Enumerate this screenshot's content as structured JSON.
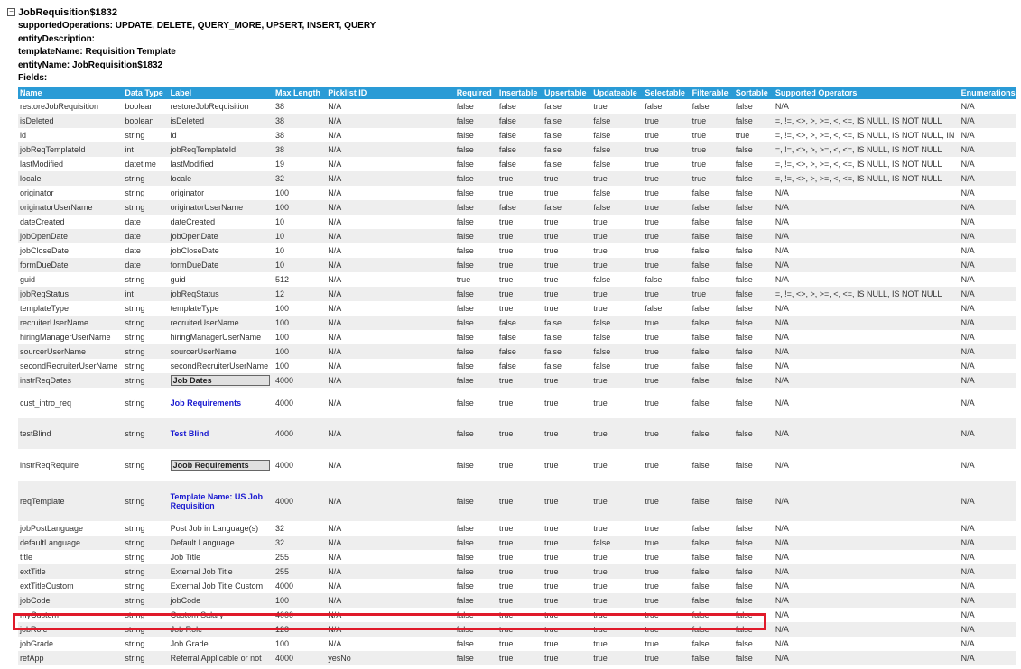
{
  "entity": {
    "title": "JobRequisition$1832",
    "meta": [
      {
        "key": "supportedOperations:",
        "value": "UPDATE, DELETE, QUERY_MORE, UPSERT, INSERT, QUERY"
      },
      {
        "key": "entityDescription:",
        "value": ""
      },
      {
        "key": "templateName:",
        "value": "Requisition Template"
      },
      {
        "key": "entityName:",
        "value": "JobRequisition$1832"
      },
      {
        "key": "Fields:",
        "value": ""
      }
    ]
  },
  "table": {
    "columns": [
      "Name",
      "Data Type",
      "Label",
      "Max Length",
      "Picklist ID",
      "Required",
      "Insertable",
      "Upsertable",
      "Updateable",
      "Selectable",
      "Filterable",
      "Sortable",
      "Supported Operators",
      "Enumerations"
    ],
    "rows": [
      [
        "restoreJobRequisition",
        "boolean",
        "restoreJobRequisition",
        "38",
        "N/A",
        "false",
        "false",
        "false",
        "true",
        "false",
        "false",
        "false",
        "N/A",
        "N/A"
      ],
      [
        "isDeleted",
        "boolean",
        "isDeleted",
        "38",
        "N/A",
        "false",
        "false",
        "false",
        "false",
        "true",
        "true",
        "false",
        "=, !=, <>, >, >=, <, <=, IS NULL, IS NOT NULL",
        "N/A"
      ],
      [
        "id",
        "string",
        "id",
        "38",
        "N/A",
        "false",
        "false",
        "false",
        "false",
        "true",
        "true",
        "true",
        "=, !=, <>, >, >=, <, <=, IS NULL, IS NOT NULL, IN",
        "N/A"
      ],
      [
        "jobReqTemplateId",
        "int",
        "jobReqTemplateId",
        "38",
        "N/A",
        "false",
        "false",
        "false",
        "false",
        "true",
        "true",
        "false",
        "=, !=, <>, >, >=, <, <=, IS NULL, IS NOT NULL",
        "N/A"
      ],
      [
        "lastModified",
        "datetime",
        "lastModified",
        "19",
        "N/A",
        "false",
        "false",
        "false",
        "false",
        "true",
        "true",
        "false",
        "=, !=, <>, >, >=, <, <=, IS NULL, IS NOT NULL",
        "N/A"
      ],
      [
        "locale",
        "string",
        "locale",
        "32",
        "N/A",
        "false",
        "true",
        "true",
        "true",
        "true",
        "true",
        "false",
        "=, !=, <>, >, >=, <, <=, IS NULL, IS NOT NULL",
        "N/A"
      ],
      [
        "originator",
        "string",
        "originator",
        "100",
        "N/A",
        "false",
        "true",
        "true",
        "false",
        "true",
        "false",
        "false",
        "N/A",
        "N/A"
      ],
      [
        "originatorUserName",
        "string",
        "originatorUserName",
        "100",
        "N/A",
        "false",
        "false",
        "false",
        "false",
        "true",
        "false",
        "false",
        "N/A",
        "N/A"
      ],
      [
        "dateCreated",
        "date",
        "dateCreated",
        "10",
        "N/A",
        "false",
        "true",
        "true",
        "true",
        "true",
        "false",
        "false",
        "N/A",
        "N/A"
      ],
      [
        "jobOpenDate",
        "date",
        "jobOpenDate",
        "10",
        "N/A",
        "false",
        "true",
        "true",
        "true",
        "true",
        "false",
        "false",
        "N/A",
        "N/A"
      ],
      [
        "jobCloseDate",
        "date",
        "jobCloseDate",
        "10",
        "N/A",
        "false",
        "true",
        "true",
        "true",
        "true",
        "false",
        "false",
        "N/A",
        "N/A"
      ],
      [
        "formDueDate",
        "date",
        "formDueDate",
        "10",
        "N/A",
        "false",
        "true",
        "true",
        "true",
        "true",
        "false",
        "false",
        "N/A",
        "N/A"
      ],
      [
        "guid",
        "string",
        "guid",
        "512",
        "N/A",
        "true",
        "true",
        "true",
        "false",
        "false",
        "false",
        "false",
        "N/A",
        "N/A"
      ],
      [
        "jobReqStatus",
        "int",
        "jobReqStatus",
        "12",
        "N/A",
        "false",
        "true",
        "true",
        "true",
        "true",
        "true",
        "false",
        "=, !=, <>, >, >=, <, <=, IS NULL, IS NOT NULL",
        "N/A"
      ],
      [
        "templateType",
        "string",
        "templateType",
        "100",
        "N/A",
        "false",
        "true",
        "true",
        "true",
        "false",
        "false",
        "false",
        "N/A",
        "N/A"
      ],
      [
        "recruiterUserName",
        "string",
        "recruiterUserName",
        "100",
        "N/A",
        "false",
        "false",
        "false",
        "false",
        "true",
        "false",
        "false",
        "N/A",
        "N/A"
      ],
      [
        "hiringManagerUserName",
        "string",
        "hiringManagerUserName",
        "100",
        "N/A",
        "false",
        "false",
        "false",
        "false",
        "true",
        "false",
        "false",
        "N/A",
        "N/A"
      ],
      [
        "sourcerUserName",
        "string",
        "sourcerUserName",
        "100",
        "N/A",
        "false",
        "false",
        "false",
        "false",
        "true",
        "false",
        "false",
        "N/A",
        "N/A"
      ],
      [
        "secondRecruiterUserName",
        "string",
        "secondRecruiterUserName",
        "100",
        "N/A",
        "false",
        "false",
        "false",
        "false",
        "true",
        "false",
        "false",
        "N/A",
        "N/A"
      ],
      [
        "instrReqDates",
        "string",
        "Job Dates",
        "4000",
        "N/A",
        "false",
        "true",
        "true",
        "true",
        "true",
        "false",
        "false",
        "N/A",
        "N/A"
      ],
      [
        "cust_intro_req",
        "string",
        "Job Requirements",
        "4000",
        "N/A",
        "false",
        "true",
        "true",
        "true",
        "true",
        "false",
        "false",
        "N/A",
        "N/A"
      ],
      [
        "testBlind",
        "string",
        "Test Blind",
        "4000",
        "N/A",
        "false",
        "true",
        "true",
        "true",
        "true",
        "false",
        "false",
        "N/A",
        "N/A"
      ],
      [
        "instrReqRequire",
        "string",
        "Joob Requirements",
        "4000",
        "N/A",
        "false",
        "true",
        "true",
        "true",
        "true",
        "false",
        "false",
        "N/A",
        "N/A"
      ],
      [
        "reqTemplate",
        "string",
        "Template Name: US Job Requisition",
        "4000",
        "N/A",
        "false",
        "true",
        "true",
        "true",
        "true",
        "false",
        "false",
        "N/A",
        "N/A"
      ],
      [
        "jobPostLanguage",
        "string",
        "Post Job in Language(s)",
        "32",
        "N/A",
        "false",
        "true",
        "true",
        "true",
        "true",
        "false",
        "false",
        "N/A",
        "N/A"
      ],
      [
        "defaultLanguage",
        "string",
        "Default Language",
        "32",
        "N/A",
        "false",
        "true",
        "true",
        "false",
        "true",
        "false",
        "false",
        "N/A",
        "N/A"
      ],
      [
        "title",
        "string",
        "Job Title",
        "255",
        "N/A",
        "false",
        "true",
        "true",
        "true",
        "true",
        "false",
        "false",
        "N/A",
        "N/A"
      ],
      [
        "extTitle",
        "string",
        "External Job Title",
        "255",
        "N/A",
        "false",
        "true",
        "true",
        "true",
        "true",
        "false",
        "false",
        "N/A",
        "N/A"
      ],
      [
        "extTitleCustom",
        "string",
        "External Job Title Custom",
        "4000",
        "N/A",
        "false",
        "true",
        "true",
        "true",
        "true",
        "false",
        "false",
        "N/A",
        "N/A"
      ],
      [
        "jobCode",
        "string",
        "jobCode",
        "100",
        "N/A",
        "false",
        "true",
        "true",
        "true",
        "true",
        "false",
        "false",
        "N/A",
        "N/A"
      ],
      [
        "myCustom",
        "string",
        "Custom Salary",
        "4000",
        "N/A",
        "false",
        "true",
        "true",
        "true",
        "true",
        "false",
        "false",
        "N/A",
        "N/A"
      ],
      [
        "jobRole",
        "string",
        "Job Role",
        "128",
        "N/A",
        "false",
        "true",
        "true",
        "true",
        "true",
        "false",
        "false",
        "N/A",
        "N/A"
      ],
      [
        "jobGrade",
        "string",
        "Job Grade",
        "100",
        "N/A",
        "false",
        "true",
        "true",
        "true",
        "true",
        "false",
        "false",
        "N/A",
        "N/A"
      ],
      [
        "refApp",
        "string",
        "Referral Applicable or not",
        "4000",
        "yesNo",
        "false",
        "true",
        "true",
        "true",
        "true",
        "false",
        "false",
        "N/A",
        "N/A"
      ]
    ]
  },
  "colors": {
    "header_bg": "#2a9bd6",
    "highlight": "#e01a2a",
    "alt_row": "#eeeeee"
  }
}
